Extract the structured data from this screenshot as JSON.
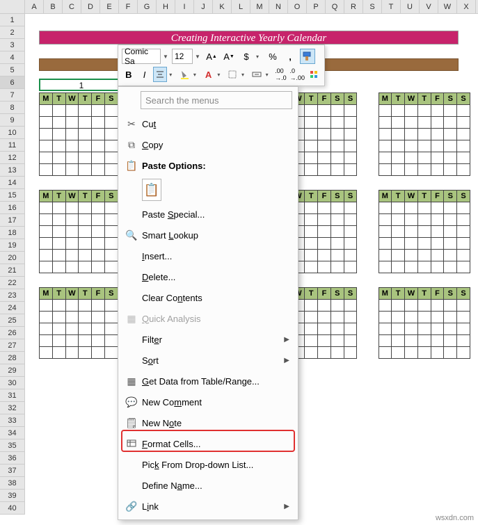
{
  "columns": [
    "A",
    "B",
    "C",
    "D",
    "E",
    "F",
    "G",
    "H",
    "I",
    "J",
    "K",
    "L",
    "M",
    "N",
    "O",
    "P",
    "Q",
    "R",
    "S",
    "T",
    "U",
    "V",
    "W",
    "X"
  ],
  "rows": [
    "1",
    "2",
    "3",
    "4",
    "5",
    "6",
    "7",
    "8",
    "9",
    "10",
    "11",
    "12",
    "13",
    "14",
    "15",
    "16",
    "17",
    "18",
    "19",
    "20",
    "21",
    "22",
    "23",
    "24",
    "25",
    "26",
    "27",
    "28",
    "29",
    "30",
    "31",
    "32",
    "33",
    "34",
    "35",
    "36",
    "37",
    "38",
    "39",
    "40"
  ],
  "title": "Creating Interactive Yearly Calendar",
  "selected_cell_value": "1",
  "days": [
    "M",
    "T",
    "W",
    "T",
    "F",
    "S",
    "S"
  ],
  "mini_toolbar": {
    "font": "Comic Sa",
    "size": "12",
    "bold": "B",
    "italic": "I"
  },
  "context_menu": {
    "search_placeholder": "Search the menus",
    "cut": "Cut",
    "copy": "Copy",
    "paste_options": "Paste Options:",
    "paste_special": "Paste Special...",
    "smart_lookup": "Smart Lookup",
    "insert": "Insert...",
    "delete": "Delete...",
    "clear_contents": "Clear Contents",
    "quick_analysis": "Quick Analysis",
    "filter": "Filter",
    "sort": "Sort",
    "get_data": "Get Data from Table/Range...",
    "new_comment": "New Comment",
    "new_note": "New Note",
    "format_cells": "Format Cells...",
    "pick_list": "Pick From Drop-down List...",
    "define_name": "Define Name...",
    "link": "Link"
  },
  "watermark": "wsxdn.com"
}
